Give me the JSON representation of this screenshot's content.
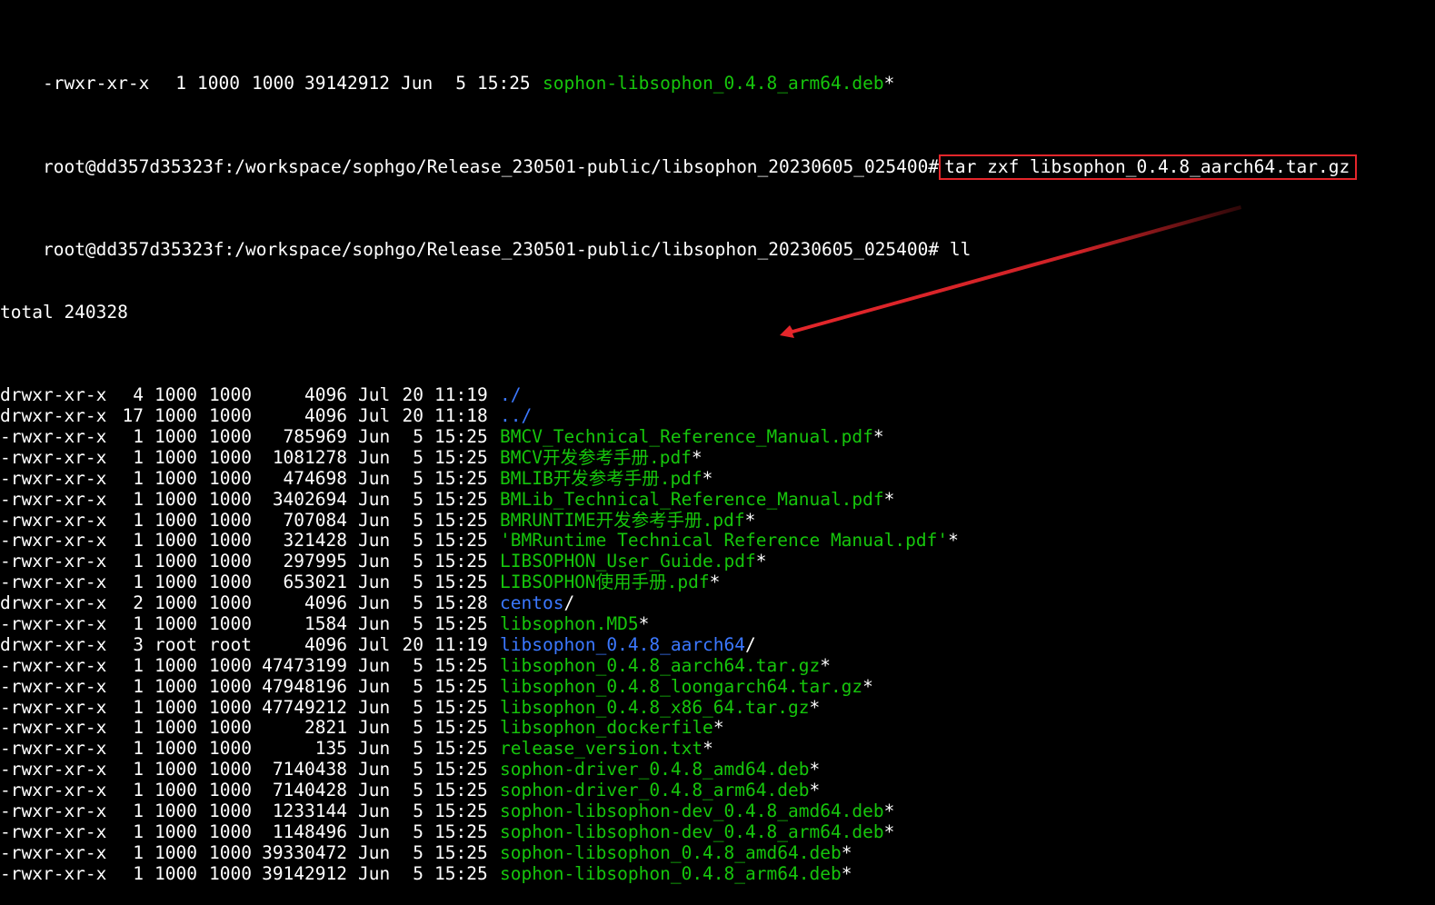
{
  "terminal": {
    "top_partial": {
      "perm": "-rwxr-xr-x",
      "links": "1",
      "owner": "1000",
      "group": "1000",
      "size": "39142912",
      "month": "Jun",
      "day": "5",
      "time": "15:25",
      "name": "sophon-libsophon_0.4.8_arm64.deb",
      "suffix": "*"
    },
    "prompt": "root@dd357d35323f:/workspace/sophgo/Release_230501-public/libsophon_20230605_025400#",
    "command_1": "tar zxf libsophon_0.4.8_aarch64.tar.gz",
    "command_2": "ll",
    "total": "total 240328",
    "entries": [
      {
        "perm": "drwxr-xr-x",
        "links": "4",
        "owner": "1000",
        "group": "1000",
        "size": "4096",
        "month": "Jul",
        "day": "20",
        "time": "11:19",
        "name": "./",
        "type": "dir",
        "suffix": ""
      },
      {
        "perm": "drwxr-xr-x",
        "links": "17",
        "owner": "1000",
        "group": "1000",
        "size": "4096",
        "month": "Jul",
        "day": "20",
        "time": "11:18",
        "name": "../",
        "type": "dir",
        "suffix": ""
      },
      {
        "perm": "-rwxr-xr-x",
        "links": "1",
        "owner": "1000",
        "group": "1000",
        "size": "785969",
        "month": "Jun",
        "day": "5",
        "time": "15:25",
        "name": "BMCV_Technical_Reference_Manual.pdf",
        "type": "exec",
        "suffix": "*"
      },
      {
        "perm": "-rwxr-xr-x",
        "links": "1",
        "owner": "1000",
        "group": "1000",
        "size": "1081278",
        "month": "Jun",
        "day": "5",
        "time": "15:25",
        "name": "BMCV开发参考手册.pdf",
        "type": "exec",
        "suffix": "*"
      },
      {
        "perm": "-rwxr-xr-x",
        "links": "1",
        "owner": "1000",
        "group": "1000",
        "size": "474698",
        "month": "Jun",
        "day": "5",
        "time": "15:25",
        "name": "BMLIB开发参考手册.pdf",
        "type": "exec",
        "suffix": "*"
      },
      {
        "perm": "-rwxr-xr-x",
        "links": "1",
        "owner": "1000",
        "group": "1000",
        "size": "3402694",
        "month": "Jun",
        "day": "5",
        "time": "15:25",
        "name": "BMLib_Technical_Reference_Manual.pdf",
        "type": "exec",
        "suffix": "*"
      },
      {
        "perm": "-rwxr-xr-x",
        "links": "1",
        "owner": "1000",
        "group": "1000",
        "size": "707084",
        "month": "Jun",
        "day": "5",
        "time": "15:25",
        "name": "BMRUNTIME开发参考手册.pdf",
        "type": "exec",
        "suffix": "*"
      },
      {
        "perm": "-rwxr-xr-x",
        "links": "1",
        "owner": "1000",
        "group": "1000",
        "size": "321428",
        "month": "Jun",
        "day": "5",
        "time": "15:25",
        "name": "'BMRuntime Technical Reference Manual.pdf'",
        "type": "exec",
        "suffix": "*"
      },
      {
        "perm": "-rwxr-xr-x",
        "links": "1",
        "owner": "1000",
        "group": "1000",
        "size": "297995",
        "month": "Jun",
        "day": "5",
        "time": "15:25",
        "name": "LIBSOPHON_User_Guide.pdf",
        "type": "exec",
        "suffix": "*"
      },
      {
        "perm": "-rwxr-xr-x",
        "links": "1",
        "owner": "1000",
        "group": "1000",
        "size": "653021",
        "month": "Jun",
        "day": "5",
        "time": "15:25",
        "name": "LIBSOPHON使用手册.pdf",
        "type": "exec",
        "suffix": "*"
      },
      {
        "perm": "drwxr-xr-x",
        "links": "2",
        "owner": "1000",
        "group": "1000",
        "size": "4096",
        "month": "Jun",
        "day": "5",
        "time": "15:28",
        "name": "centos",
        "type": "dir",
        "suffix": "/"
      },
      {
        "perm": "-rwxr-xr-x",
        "links": "1",
        "owner": "1000",
        "group": "1000",
        "size": "1584",
        "month": "Jun",
        "day": "5",
        "time": "15:25",
        "name": "libsophon.MD5",
        "type": "exec",
        "suffix": "*"
      },
      {
        "perm": "drwxr-xr-x",
        "links": "3",
        "owner": "root",
        "group": "root",
        "size": "4096",
        "month": "Jul",
        "day": "20",
        "time": "11:19",
        "name": "libsophon_0.4.8_aarch64",
        "type": "dir",
        "suffix": "/"
      },
      {
        "perm": "-rwxr-xr-x",
        "links": "1",
        "owner": "1000",
        "group": "1000",
        "size": "47473199",
        "month": "Jun",
        "day": "5",
        "time": "15:25",
        "name": "libsophon_0.4.8_aarch64.tar.gz",
        "type": "exec",
        "suffix": "*"
      },
      {
        "perm": "-rwxr-xr-x",
        "links": "1",
        "owner": "1000",
        "group": "1000",
        "size": "47948196",
        "month": "Jun",
        "day": "5",
        "time": "15:25",
        "name": "libsophon_0.4.8_loongarch64.tar.gz",
        "type": "exec",
        "suffix": "*"
      },
      {
        "perm": "-rwxr-xr-x",
        "links": "1",
        "owner": "1000",
        "group": "1000",
        "size": "47749212",
        "month": "Jun",
        "day": "5",
        "time": "15:25",
        "name": "libsophon_0.4.8_x86_64.tar.gz",
        "type": "exec",
        "suffix": "*"
      },
      {
        "perm": "-rwxr-xr-x",
        "links": "1",
        "owner": "1000",
        "group": "1000",
        "size": "2821",
        "month": "Jun",
        "day": "5",
        "time": "15:25",
        "name": "libsophon_dockerfile",
        "type": "exec",
        "suffix": "*"
      },
      {
        "perm": "-rwxr-xr-x",
        "links": "1",
        "owner": "1000",
        "group": "1000",
        "size": "135",
        "month": "Jun",
        "day": "5",
        "time": "15:25",
        "name": "release_version.txt",
        "type": "exec",
        "suffix": "*"
      },
      {
        "perm": "-rwxr-xr-x",
        "links": "1",
        "owner": "1000",
        "group": "1000",
        "size": "7140438",
        "month": "Jun",
        "day": "5",
        "time": "15:25",
        "name": "sophon-driver_0.4.8_amd64.deb",
        "type": "exec",
        "suffix": "*"
      },
      {
        "perm": "-rwxr-xr-x",
        "links": "1",
        "owner": "1000",
        "group": "1000",
        "size": "7140428",
        "month": "Jun",
        "day": "5",
        "time": "15:25",
        "name": "sophon-driver_0.4.8_arm64.deb",
        "type": "exec",
        "suffix": "*"
      },
      {
        "perm": "-rwxr-xr-x",
        "links": "1",
        "owner": "1000",
        "group": "1000",
        "size": "1233144",
        "month": "Jun",
        "day": "5",
        "time": "15:25",
        "name": "sophon-libsophon-dev_0.4.8_amd64.deb",
        "type": "exec",
        "suffix": "*"
      },
      {
        "perm": "-rwxr-xr-x",
        "links": "1",
        "owner": "1000",
        "group": "1000",
        "size": "1148496",
        "month": "Jun",
        "day": "5",
        "time": "15:25",
        "name": "sophon-libsophon-dev_0.4.8_arm64.deb",
        "type": "exec",
        "suffix": "*"
      },
      {
        "perm": "-rwxr-xr-x",
        "links": "1",
        "owner": "1000",
        "group": "1000",
        "size": "39330472",
        "month": "Jun",
        "day": "5",
        "time": "15:25",
        "name": "sophon-libsophon_0.4.8_amd64.deb",
        "type": "exec",
        "suffix": "*"
      },
      {
        "perm": "-rwxr-xr-x",
        "links": "1",
        "owner": "1000",
        "group": "1000",
        "size": "39142912",
        "month": "Jun",
        "day": "5",
        "time": "15:25",
        "name": "sophon-libsophon_0.4.8_arm64.deb",
        "type": "exec",
        "suffix": "*"
      }
    ]
  },
  "colors": {
    "background": "#000000",
    "text": "#ffffff",
    "executable": "#16c60c",
    "directory": "#3b78ff",
    "highlight_box": "#e5262b",
    "arrow": "#e5262b"
  },
  "annotations": {
    "highlight": "box around command_1",
    "arrow": "arrow pointing at libsophon_0.4.8_aarch64 directory entry"
  }
}
